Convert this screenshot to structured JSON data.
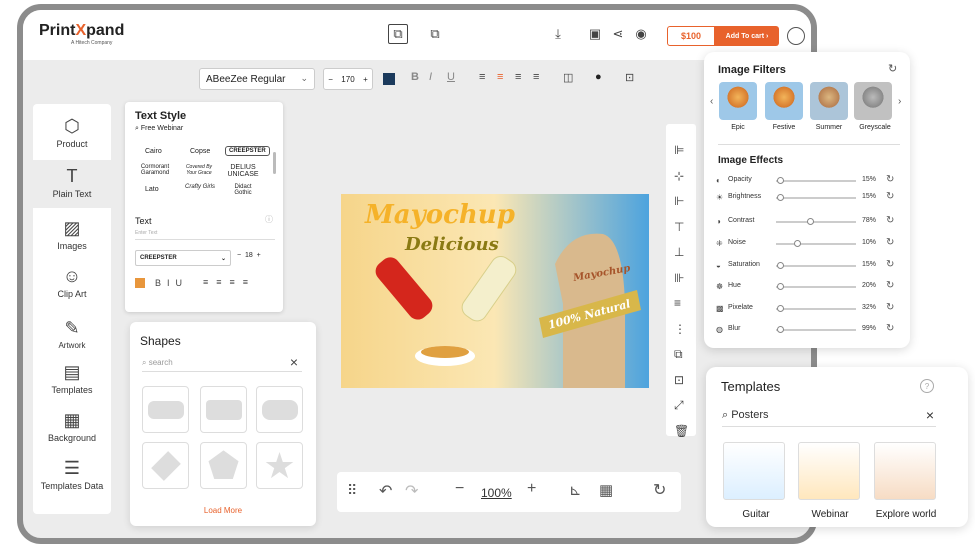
{
  "header": {
    "logo_main": "Print",
    "logo_x": "X",
    "logo_rest": "pand",
    "logo_sub": "A Hitech Company",
    "price": "$100",
    "cart_label": "Add To cart"
  },
  "toolbar": {
    "font_family": "ABeeZee Regular",
    "font_size": "170"
  },
  "sidebar": {
    "items": [
      {
        "label": "Product",
        "icon": "cube-icon"
      },
      {
        "label": "Plain Text",
        "icon": "text-icon"
      },
      {
        "label": "Images",
        "icon": "image-icon"
      },
      {
        "label": "Clip Art",
        "icon": "smiley-icon"
      },
      {
        "label": "Artwork",
        "icon": "brush-icon"
      },
      {
        "label": "Templates",
        "icon": "templates-icon"
      },
      {
        "label": "Background",
        "icon": "background-icon"
      },
      {
        "label": "Templates Data",
        "icon": "data-icon"
      }
    ]
  },
  "text_style": {
    "title": "Text Style",
    "search_value": "Free Webinar",
    "fonts": [
      "Cairo",
      "Copse",
      "CREEPSTER",
      "Cormorant Garamond",
      "Covered By Your Grace",
      "DELIUS UNICASE",
      "Lato",
      "Crafty Girls",
      "Didact Gothic"
    ],
    "text_label": "Text",
    "text_placeholder": "Enter Text",
    "font_select": "CREEPSTER",
    "size": "18"
  },
  "canvas": {
    "title1": "Mayochup",
    "title2": "Delicious",
    "bottle_label": "Mayochup",
    "ribbon": "100% Natural"
  },
  "bottom_bar": {
    "zoom": "100%"
  },
  "shapes": {
    "title": "Shapes",
    "search_placeholder": "search",
    "load_more": "Load More"
  },
  "filters": {
    "title": "Image Filters",
    "presets": [
      "Epic",
      "Festive",
      "Summer",
      "Greyscale"
    ],
    "effects_title": "Image Effects",
    "effects": [
      {
        "label": "Opacity",
        "value": "15%",
        "level": 0.05
      },
      {
        "label": "Brightness",
        "value": "15%",
        "level": 0.05
      },
      {
        "label": "Contrast",
        "value": "78%",
        "level": 0.42
      },
      {
        "label": "Noise",
        "value": "10%",
        "level": 0.26
      },
      {
        "label": "Saturation",
        "value": "15%",
        "level": 0.05
      },
      {
        "label": "Hue",
        "value": "20%",
        "level": 0.05
      },
      {
        "label": "Pixelate",
        "value": "32%",
        "level": 0.05
      },
      {
        "label": "Blur",
        "value": "99%",
        "level": 0.05
      }
    ]
  },
  "templates": {
    "title": "Templates",
    "search_value": "Posters",
    "items": [
      "Guitar",
      "Webinar",
      "Explore world"
    ]
  }
}
